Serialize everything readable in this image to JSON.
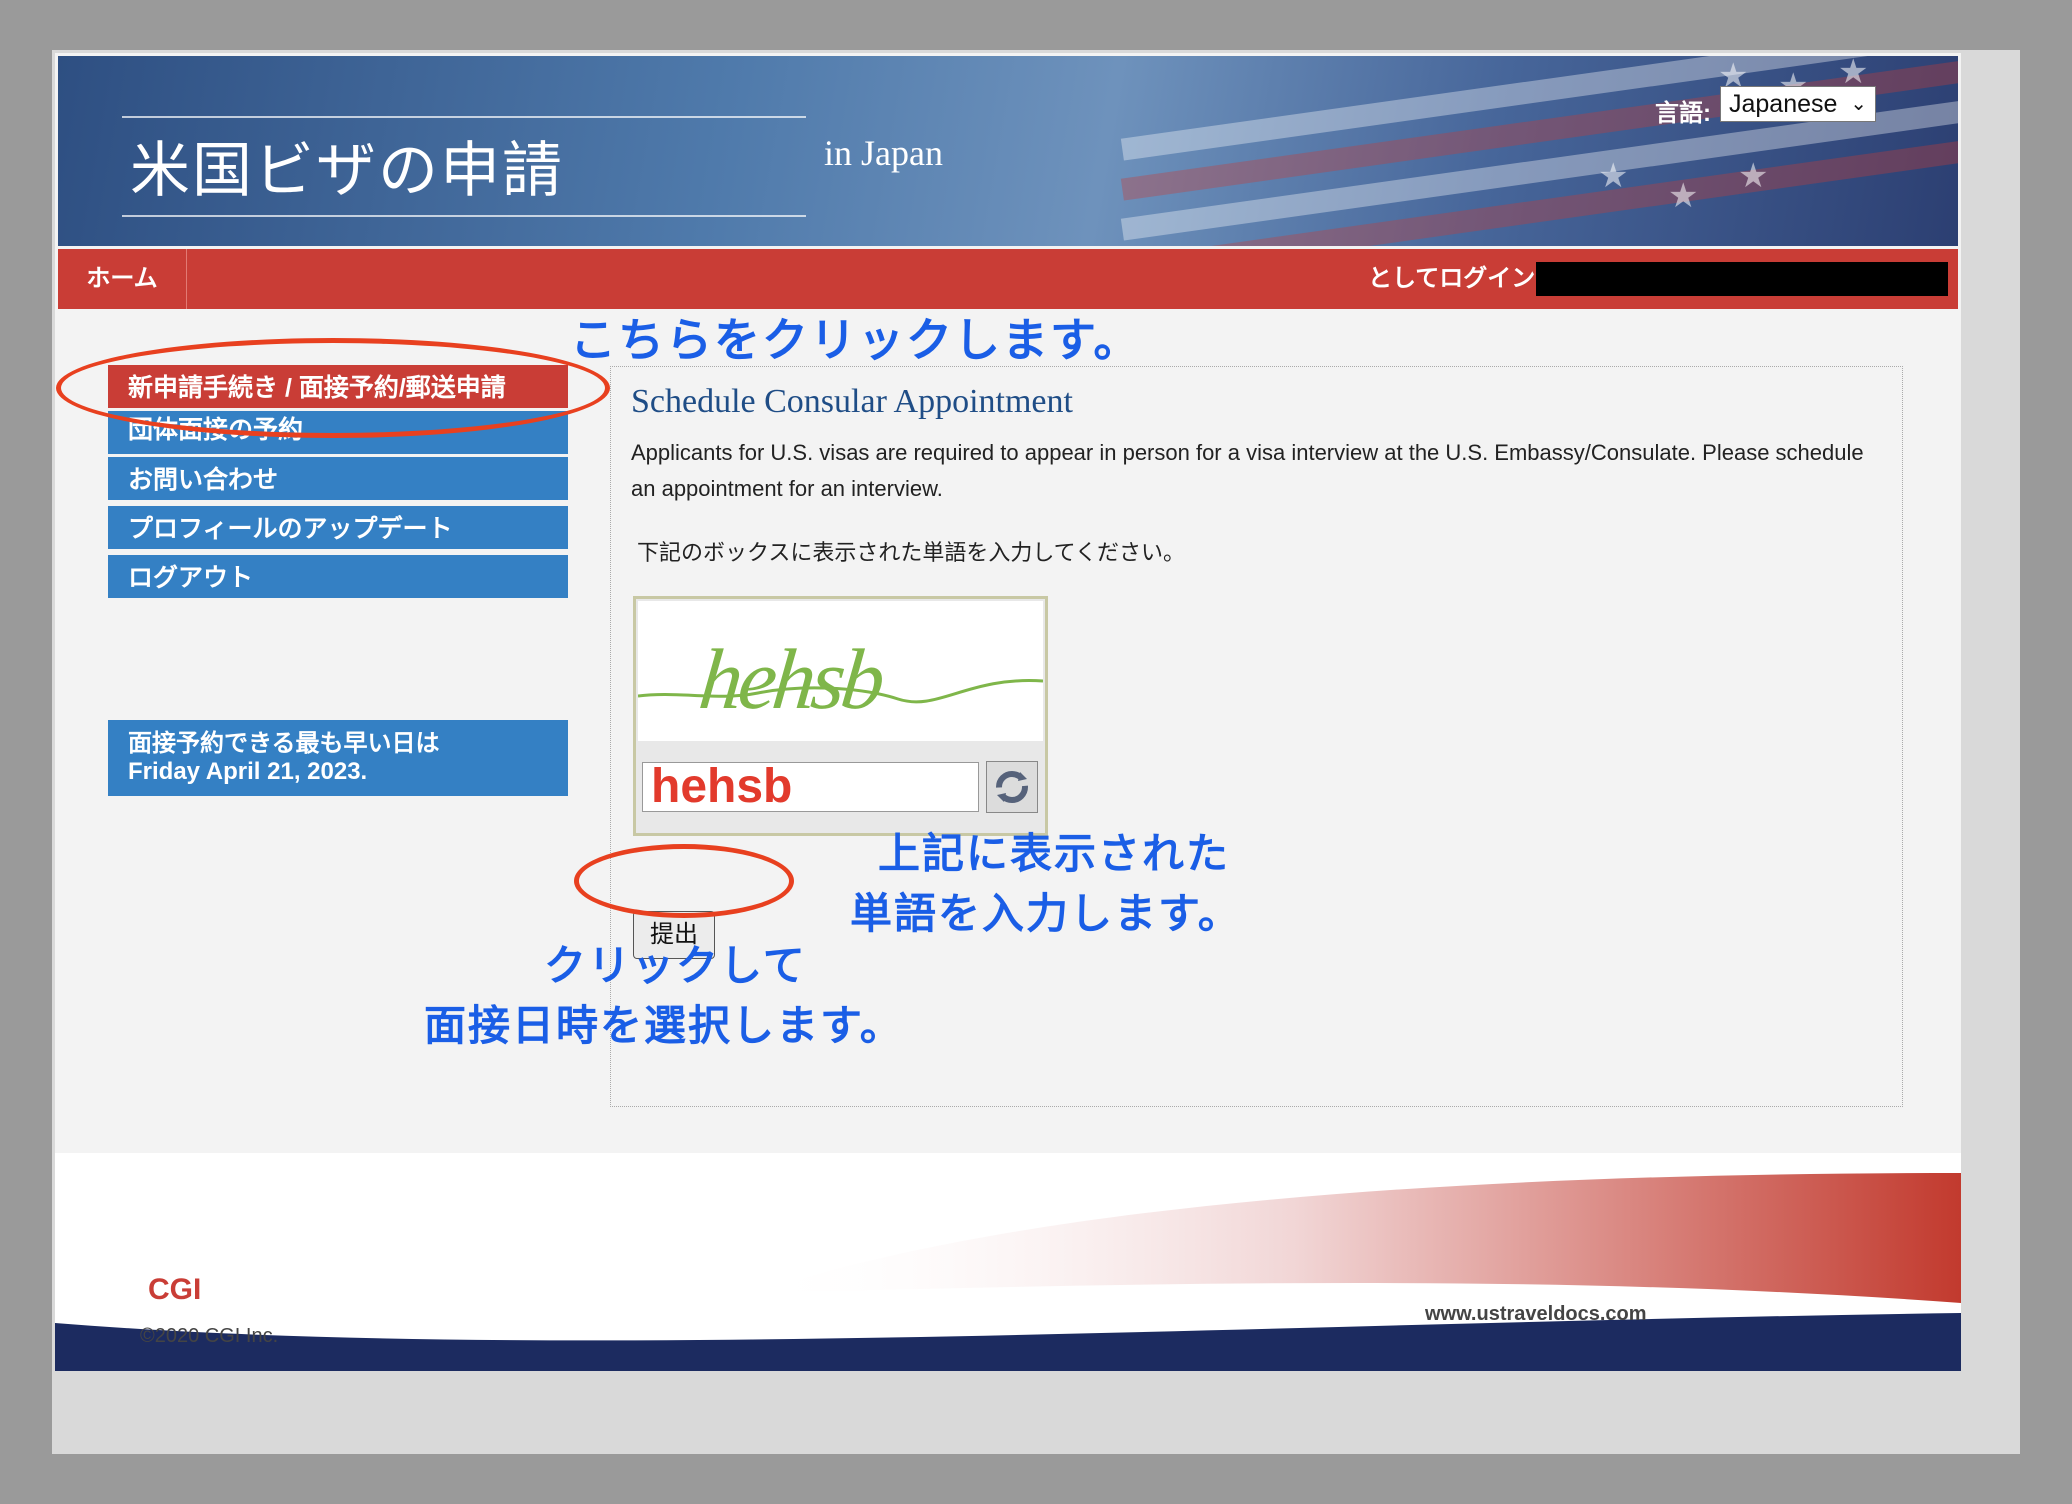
{
  "header": {
    "title": "米国ビザの申請",
    "country": "in  Japan",
    "language_label": "言語:",
    "language_value": "Japanese"
  },
  "nav": {
    "home": "ホーム",
    "login_label": "としてログイン"
  },
  "sidebar": {
    "items": [
      {
        "label": "新申請手続き / 面接予約/郵送申請",
        "active": true
      },
      {
        "label": "団体面接の予約"
      },
      {
        "label": "お問い合わせ"
      },
      {
        "label": "プロフィールのアップデート"
      },
      {
        "label": "ログアウト"
      }
    ],
    "earliest_line1": "面接予約できる最も早い日は",
    "earliest_line2": "Friday April 21, 2023."
  },
  "content": {
    "title": "Schedule Consular Appointment",
    "description": "Applicants for U.S. visas are required to appear in person for a visa interview at the U.S. Embassy/Consulate. Please schedule an appointment for an interview.",
    "instruction": "下記のボックスに表示された単語を入力してください。",
    "captcha_image_text": "hehsb",
    "captcha_input_value": "hehsb",
    "submit_label": "提出"
  },
  "annotations": {
    "click_here": "こちらをクリックします。",
    "enter_word_line1": "上記に表示された",
    "enter_word_line2": "単語を入力します。",
    "click_select_line1": "クリックして",
    "click_select_line2": "面接日時を選択します。"
  },
  "footer": {
    "logo": "CGI",
    "copyright": "©2020 CGI Inc.",
    "url": "www.ustraveldocs.com"
  },
  "colors": {
    "nav_red": "#c93d36",
    "menu_blue": "#3480c4",
    "annotation_blue": "#1a5ee6",
    "annotation_red": "#e8401f",
    "title_blue": "#1f4d86"
  }
}
